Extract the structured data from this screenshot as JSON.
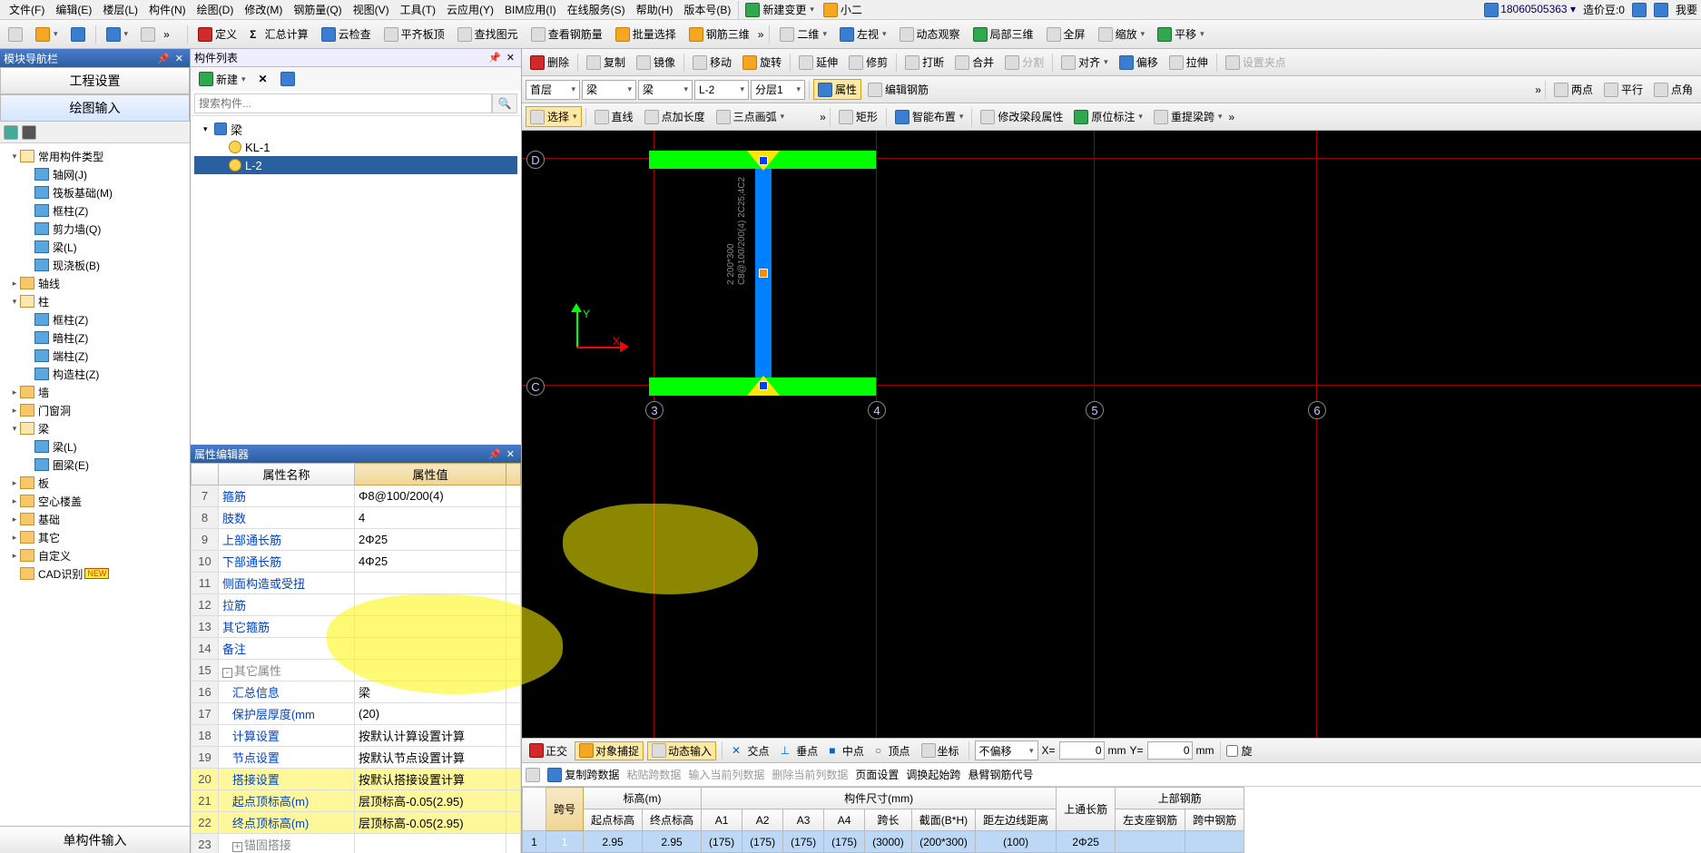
{
  "menubar": {
    "items": [
      "文件(F)",
      "编辑(E)",
      "楼层(L)",
      "构件(N)",
      "绘图(D)",
      "修改(M)",
      "钢筋量(Q)",
      "视图(V)",
      "工具(T)",
      "云应用(Y)",
      "BIM应用(I)",
      "在线服务(S)",
      "帮助(H)",
      "版本号(B)"
    ],
    "new_change": "新建变更",
    "user_suffix": "小二",
    "uid": "18060505363",
    "credit": "造价豆:0",
    "wode": "我要"
  },
  "toolbar1": {
    "define": "定义",
    "sumcalc": "汇总计算",
    "cloudcheck": "云检查",
    "pingqi": "平齐板顶",
    "findelem": "查找图元",
    "ckgjl": "查看钢筋量",
    "plxz": "批量选择",
    "gjsw": "钢筋三维",
    "erwei": "二维",
    "zuoshi": "左视",
    "dtgc": "动态观察",
    "jbsw": "局部三维",
    "quanping": "全屏",
    "suofang": "缩放",
    "pingyi": "平移"
  },
  "left": {
    "nav_title": "模块导航栏",
    "tab_proj": "工程设置",
    "tab_draw": "绘图输入",
    "tree": [
      {
        "lvl": 1,
        "arrow": "▾",
        "ico": "folder-open",
        "label": "常用构件类型"
      },
      {
        "lvl": 2,
        "ico": "node",
        "label": "轴网(J)"
      },
      {
        "lvl": 2,
        "ico": "node",
        "label": "筏板基础(M)"
      },
      {
        "lvl": 2,
        "ico": "node",
        "label": "框柱(Z)"
      },
      {
        "lvl": 2,
        "ico": "node",
        "label": "剪力墙(Q)"
      },
      {
        "lvl": 2,
        "ico": "node",
        "label": "梁(L)"
      },
      {
        "lvl": 2,
        "ico": "node",
        "label": "现浇板(B)"
      },
      {
        "lvl": 1,
        "arrow": "▸",
        "ico": "folder",
        "label": "轴线"
      },
      {
        "lvl": 1,
        "arrow": "▾",
        "ico": "folder-open",
        "label": "柱"
      },
      {
        "lvl": 2,
        "ico": "node",
        "label": "框柱(Z)"
      },
      {
        "lvl": 2,
        "ico": "node",
        "label": "暗柱(Z)"
      },
      {
        "lvl": 2,
        "ico": "node",
        "label": "端柱(Z)"
      },
      {
        "lvl": 2,
        "ico": "node",
        "label": "构造柱(Z)"
      },
      {
        "lvl": 1,
        "arrow": "▸",
        "ico": "folder",
        "label": "墙"
      },
      {
        "lvl": 1,
        "arrow": "▸",
        "ico": "folder",
        "label": "门窗洞"
      },
      {
        "lvl": 1,
        "arrow": "▾",
        "ico": "folder-open",
        "label": "梁"
      },
      {
        "lvl": 2,
        "ico": "node",
        "label": "梁(L)"
      },
      {
        "lvl": 2,
        "ico": "node",
        "label": "圈梁(E)"
      },
      {
        "lvl": 1,
        "arrow": "▸",
        "ico": "folder",
        "label": "板"
      },
      {
        "lvl": 1,
        "arrow": "▸",
        "ico": "folder",
        "label": "空心楼盖"
      },
      {
        "lvl": 1,
        "arrow": "▸",
        "ico": "folder",
        "label": "基础"
      },
      {
        "lvl": 1,
        "arrow": "▸",
        "ico": "folder",
        "label": "其它"
      },
      {
        "lvl": 1,
        "arrow": "▸",
        "ico": "folder",
        "label": "自定义"
      },
      {
        "lvl": 1,
        "ico": "folder",
        "label": "CAD识别",
        "new": true
      }
    ],
    "single_input": "单构件输入"
  },
  "comp": {
    "title": "构件列表",
    "new": "新建",
    "search_ph": "搜索构件...",
    "root": "梁",
    "items": [
      "KL-1",
      "L-2"
    ],
    "selected": 1
  },
  "prop": {
    "title": "属性编辑器",
    "col_name": "属性名称",
    "col_val": "属性值",
    "rows": [
      {
        "n": 7,
        "name": "箍筋",
        "val": "Φ8@100/200(4)"
      },
      {
        "n": 8,
        "name": "肢数",
        "val": "4"
      },
      {
        "n": 9,
        "name": "上部通长筋",
        "val": "2Φ25"
      },
      {
        "n": 10,
        "name": "下部通长筋",
        "val": "4Φ25"
      },
      {
        "n": 11,
        "name": "侧面构造或受扭",
        "val": ""
      },
      {
        "n": 12,
        "name": "拉筋",
        "val": ""
      },
      {
        "n": 13,
        "name": "其它箍筋",
        "val": ""
      },
      {
        "n": 14,
        "name": "备注",
        "val": ""
      },
      {
        "n": 15,
        "name": "其它属性",
        "val": "",
        "gray": true,
        "exp": "-"
      },
      {
        "n": 16,
        "name": "汇总信息",
        "val": "梁",
        "indent": true
      },
      {
        "n": 17,
        "name": "保护层厚度(mm",
        "val": "(20)",
        "indent": true
      },
      {
        "n": 18,
        "name": "计算设置",
        "val": "按默认计算设置计算",
        "indent": true
      },
      {
        "n": 19,
        "name": "节点设置",
        "val": "按默认节点设置计算",
        "indent": true
      },
      {
        "n": 20,
        "name": "搭接设置",
        "val": "按默认搭接设置计算",
        "indent": true,
        "hl": true
      },
      {
        "n": 21,
        "name": "起点顶标高(m)",
        "val": "层顶标高-0.05(2.95)",
        "indent": true,
        "hl": true
      },
      {
        "n": 22,
        "name": "终点顶标高(m)",
        "val": "层顶标高-0.05(2.95)",
        "indent": true,
        "hl": true
      },
      {
        "n": 23,
        "name": "锚固搭接",
        "val": "",
        "gray": true,
        "exp": "+",
        "indent": true
      }
    ]
  },
  "rtools1": {
    "delete": "删除",
    "copy": "复制",
    "mirror": "镜像",
    "move": "移动",
    "rotate": "旋转",
    "extend": "延伸",
    "trim": "修剪",
    "break": "打断",
    "merge": "合并",
    "split": "分割",
    "align": "对齐",
    "offset": "偏移",
    "stretch": "拉伸",
    "setclamp": "设置夹点"
  },
  "rtools2": {
    "floor": "首层",
    "cat1": "梁",
    "cat2": "梁",
    "comp": "L-2",
    "layer": "分层1",
    "prop": "属性",
    "editrebar": "编辑钢筋",
    "twopoint": "两点",
    "parallel": "平行",
    "pointangle": "点角"
  },
  "rtools3": {
    "select": "选择",
    "line": "直线",
    "pointlen": "点加长度",
    "arc3": "三点画弧",
    "rect": "矩形",
    "smartlay": "智能布置",
    "modspan": "修改梁段属性",
    "inplace": "原位标注",
    "reraise": "重提梁跨"
  },
  "canvas": {
    "rows": [
      "D",
      "C"
    ],
    "cols": [
      "3",
      "4",
      "5",
      "6"
    ],
    "anno1": "2 200*300",
    "anno2": "C8@100/200(4) 2C25;4C2"
  },
  "snap": {
    "zhengjiao": "正交",
    "objsnap": "对象捕捉",
    "dyninput": "动态输入",
    "jiaodian": "交点",
    "chuidian": "垂点",
    "zhongdian": "中点",
    "dingdian": "顶点",
    "zuobiao": "坐标",
    "nooffset": "不偏移",
    "x": "0",
    "y": "0",
    "mm": "mm",
    "xuan": "旋"
  },
  "spanops": {
    "copy": "复制跨数据",
    "paste": "粘贴跨数据",
    "inputcur": "输入当前列数据",
    "delcur": "删除当前列数据",
    "page": "页面设置",
    "adjust": "调换起始跨",
    "cantilever": "悬臂钢筋代号"
  },
  "spantbl": {
    "grp_span": "跨号",
    "grp_elev": "标高(m)",
    "grp_size": "构件尺寸(mm)",
    "grp_top": "上部钢筋",
    "h_start": "起点标高",
    "h_end": "终点标高",
    "A1": "A1",
    "A2": "A2",
    "A3": "A3",
    "A4": "A4",
    "chg": "跨长",
    "section": "截面(B*H)",
    "edgedist": "距左边线距离",
    "toplong": "上通长筋",
    "leftsup": "左支座钢筋",
    "midspan": "跨中钢筋",
    "row": {
      "idx": "1",
      "span": "1",
      "se": "2.95",
      "ee": "2.95",
      "a1": "(175)",
      "a2": "(175)",
      "a3": "(175)",
      "a4": "(175)",
      "chg": "(3000)",
      "sec": "(200*300)",
      "edge": "(100)",
      "toplong": "2Φ25",
      "leftsup": "",
      "mid": ""
    }
  }
}
